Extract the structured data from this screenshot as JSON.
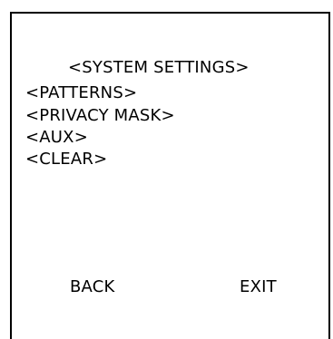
{
  "menu": {
    "title": "<SYSTEM SETTINGS>",
    "items": [
      {
        "label": "<PATTERNS>"
      },
      {
        "label": "<PRIVACY MASK>"
      },
      {
        "label": "<AUX>"
      },
      {
        "label": "<CLEAR>"
      }
    ]
  },
  "footer": {
    "back_label": "BACK",
    "exit_label": "EXIT"
  }
}
